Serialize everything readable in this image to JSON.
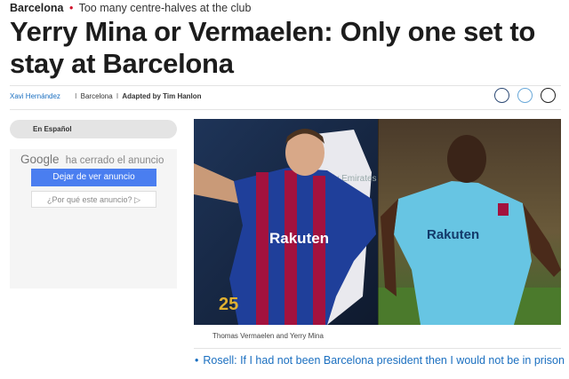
{
  "article": {
    "section": "Barcelona",
    "kicker_separator": "•",
    "kicker_text": "Too many centre-halves at the club",
    "headline": "Yerry Mina or Vermaelen: Only one set to stay at Barcelona"
  },
  "byline": {
    "author": "Xavi Hernández",
    "separator": "I",
    "outlet": "Barcelona",
    "adapted": "Adapted by Tim Hanlon"
  },
  "share": {
    "icons": [
      "share-circle-icon",
      "share-circle-icon",
      "share-circle-icon"
    ]
  },
  "sidebar": {
    "language_tab": "En Español",
    "ad": {
      "brand": "Google",
      "closed_text": "ha cerrado el anuncio",
      "stop_button": "Dejar de ver anuncio",
      "why_button": "¿Por qué este anuncio? ▷"
    }
  },
  "photo": {
    "caption": "Thomas Vermaelen and Yerry Mina",
    "left_shirt_text": "Rakuten",
    "left_number": "25",
    "right_shirt_text": "Rakuten",
    "background_shirt_text": "Fly Emirates"
  },
  "related": {
    "bullet": "•",
    "link_text": "Rosell: If I had not been Barcelona president then I would not be in prison"
  },
  "colors": {
    "accent_red": "#d0112b",
    "link_blue": "#1a6fc0",
    "ad_button_blue": "#4a7ef0",
    "barca_blue": "#1f3f9a",
    "barca_garnet": "#a3123e",
    "away_kit_cyan": "#67c5e3"
  }
}
